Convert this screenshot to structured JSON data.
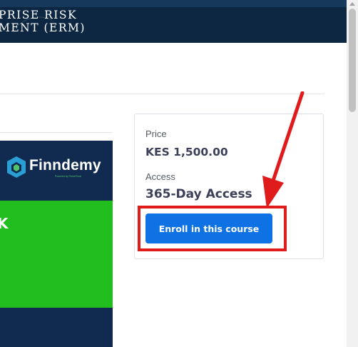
{
  "banner": {
    "title_line1": "PRISE RISK",
    "title_line2": "MENT (ERM)"
  },
  "course_image": {
    "brand": "Finndemy",
    "brand_sub": "Powered by FinnetTrust",
    "partial_text": "K"
  },
  "purchase_card": {
    "price_label": "Price",
    "price_value": "KES 1,500.00",
    "access_label": "Access",
    "access_value": "365-Day Access",
    "enroll_button": "Enroll in this course"
  },
  "annotation": {
    "color": "#e01b1b"
  },
  "colors": {
    "banner": "#0d2742",
    "button": "#0e72e4",
    "thumb_green": "#22bd1e"
  }
}
